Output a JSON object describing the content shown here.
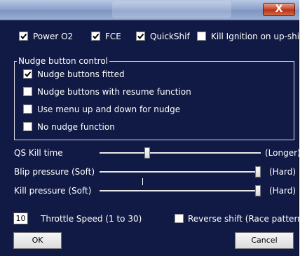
{
  "window": {
    "close_symbol": "X"
  },
  "top_options": [
    {
      "label": "Power O2",
      "checked": true
    },
    {
      "label": "FCE",
      "checked": true
    },
    {
      "label": "QuickShif",
      "checked": true
    },
    {
      "label": "Kill Ignition on up-shift",
      "checked": false
    }
  ],
  "nudge": {
    "group_label": "Nudge button control",
    "options": [
      {
        "label": "Nudge buttons fitted",
        "checked": true
      },
      {
        "label": "Nudge buttons with resume function",
        "checked": false
      },
      {
        "label": "Use menu up and down for nudge",
        "checked": false
      },
      {
        "label": "No nudge function",
        "checked": false
      }
    ]
  },
  "sliders": [
    {
      "left_label": "QS Kill time",
      "right_label": "(Longer)",
      "level": 0.29
    },
    {
      "left_label": "Blip pressure (Soft)",
      "right_label": "(Hard)",
      "level": 1.0
    },
    {
      "left_label": "Kill pressure (Soft)",
      "right_label": "(Hard)",
      "level": 1.0
    }
  ],
  "throttle": {
    "value": "10",
    "label": "Throttle Speed (1 to 30)"
  },
  "reverse_shift": {
    "label": "Reverse shift (Race pattern)",
    "checked": false
  },
  "buttons": {
    "ok": "OK",
    "cancel": "Cancel"
  },
  "colors": {
    "dialog_background": "#111a44",
    "title_bar": "#8ea4cc",
    "close_button": "#c7432a"
  }
}
